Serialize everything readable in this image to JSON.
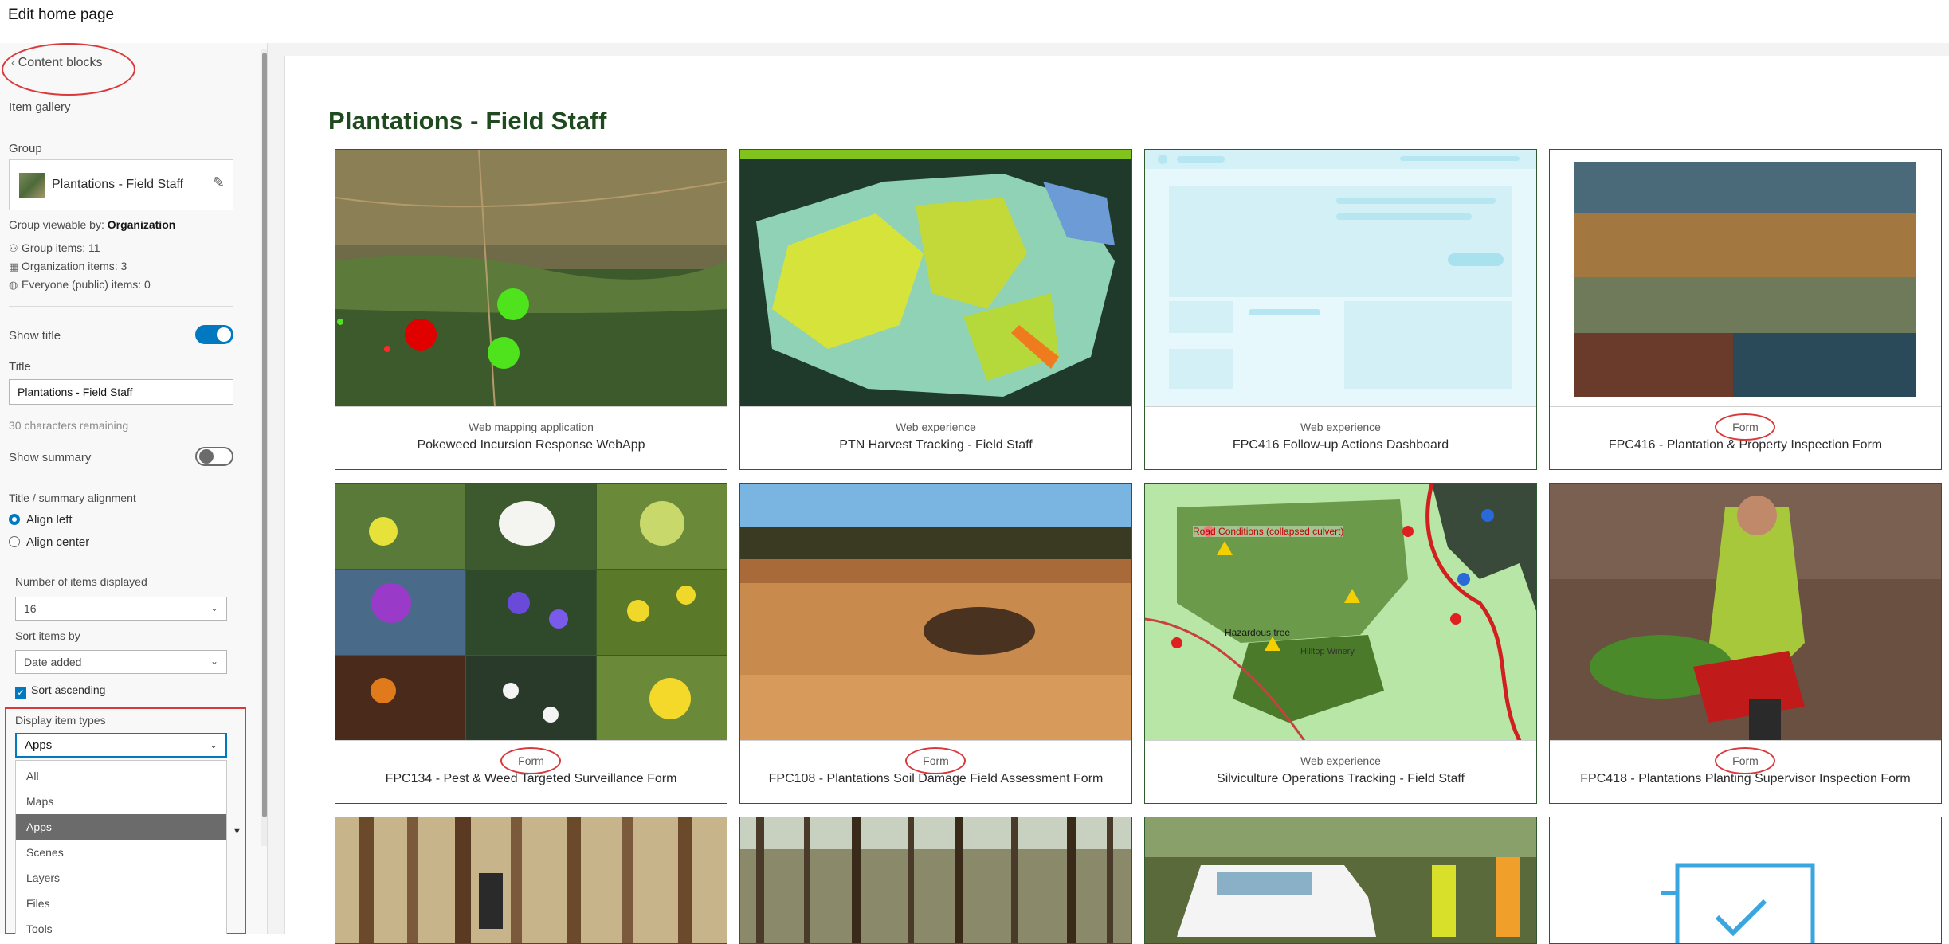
{
  "header": {
    "title": "Edit home page"
  },
  "panel": {
    "back_label": "Content blocks",
    "section_title": "Item gallery",
    "group_label": "Group",
    "group_name": "Plantations - Field Staff",
    "viewable_prefix": "Group viewable by:",
    "viewable_value": "Organization",
    "stats": [
      "Group items: 11",
      "Organization items: 3",
      "Everyone (public) items: 0"
    ],
    "show_title_label": "Show title",
    "show_title_on": true,
    "title_label": "Title",
    "title_value": "Plantations - Field Staff",
    "chars_remaining": "30 characters remaining",
    "show_summary_label": "Show summary",
    "show_summary_on": false,
    "alignment_label": "Title / summary alignment",
    "align_left": "Align left",
    "align_center": "Align center",
    "items_displayed_label": "Number of items displayed",
    "items_displayed_value": "16",
    "sort_label": "Sort items by",
    "sort_value": "Date added",
    "sort_ascending": "Sort ascending",
    "display_types_label": "Display item types",
    "display_types_value": "Apps",
    "display_types_options": [
      "All",
      "Maps",
      "Apps",
      "Scenes",
      "Layers",
      "Files",
      "Tools"
    ],
    "display_types_selected_index": 2
  },
  "preview": {
    "title": "Plantations - Field Staff",
    "cards": [
      {
        "type": "Web mapping application",
        "title": "Pokeweed Incursion Response WebApp",
        "image": "satellite-map"
      },
      {
        "type": "Web experience",
        "title": "PTN Harvest Tracking - Field Staff",
        "image": "harvest-map"
      },
      {
        "type": "Web experience",
        "title": "FPC416 Follow-up Actions Dashboard",
        "image": "placeholder-app"
      },
      {
        "type": "Form",
        "title": "FPC416 - Plantation & Property Inspection Form",
        "image": "strip-photos"
      },
      {
        "type": "Form",
        "title": "FPC134 - Pest & Weed Targeted Surveillance Form",
        "image": "flower-grid"
      },
      {
        "type": "Form",
        "title": "FPC108 - Plantations Soil Damage Field Assessment Form",
        "image": "cleared-field"
      },
      {
        "type": "Web experience",
        "title": "Silviculture Operations Tracking - Field Staff",
        "image": "operations-map"
      },
      {
        "type": "Form",
        "title": "FPC418 - Plantations Planting Supervisor Inspection Form",
        "image": "planter-photo"
      },
      {
        "type": "",
        "title": "",
        "image": "pine-trunks"
      },
      {
        "type": "",
        "title": "",
        "image": "forest"
      },
      {
        "type": "",
        "title": "",
        "image": "vehicle"
      },
      {
        "type": "",
        "title": "",
        "image": "form-icon"
      }
    ],
    "map_labels": {
      "road_conditions": "Road Conditions (collapsed culvert)",
      "hazardous_tree": "Hazardous tree",
      "winery": "Hilltop Winery"
    }
  },
  "colors": {
    "accent": "#0079c1",
    "title_green": "#1f4a1f",
    "annotation_red": "#d9393b"
  }
}
